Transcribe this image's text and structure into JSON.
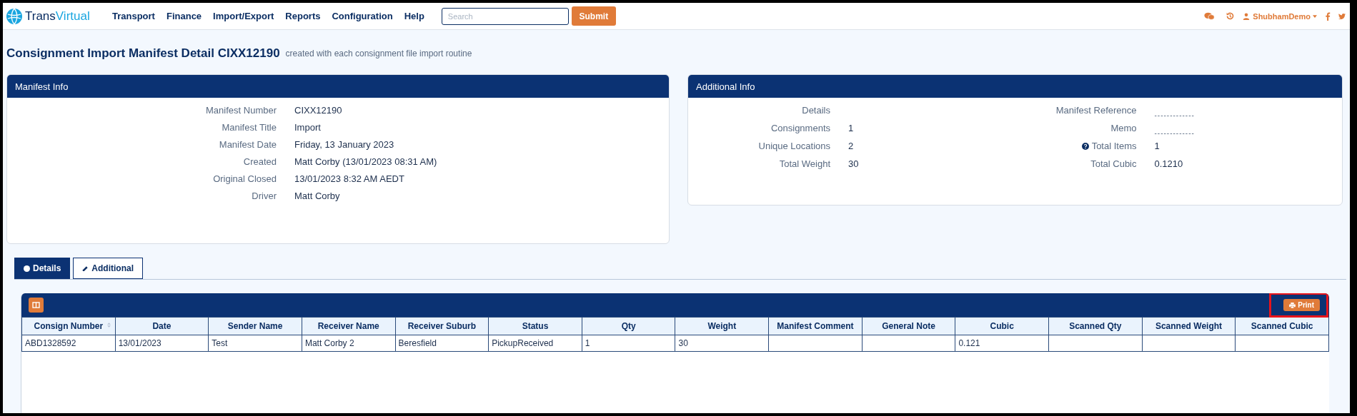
{
  "navbar": {
    "logo": [
      "Trans",
      "Virtual"
    ],
    "menu": [
      "Transport",
      "Finance",
      "Import/Export",
      "Reports",
      "Configuration",
      "Help"
    ],
    "search": {
      "placeholder": "Search"
    },
    "submit": "Submit",
    "user": "ShubhamDemo"
  },
  "page": {
    "title": "Consignment Import Manifest Detail CIXX12190",
    "subtitle": "created with each consignment file import routine"
  },
  "manifest_info": {
    "title": "Manifest Info",
    "fields": [
      {
        "label": "Manifest Number",
        "value": "CIXX12190"
      },
      {
        "label": "Manifest Title",
        "value": "Import"
      },
      {
        "label": "Manifest Date",
        "value": "Friday, 13 January 2023"
      },
      {
        "label": "Created",
        "value": "Matt Corby (13/01/2023 08:31 AM)"
      },
      {
        "label": "Original Closed",
        "value": "13/01/2023 8:32 AM AEDT"
      },
      {
        "label": "Driver",
        "value": "Matt Corby"
      }
    ]
  },
  "additional_info": {
    "title": "Additional Info",
    "left": [
      {
        "label": "Details"
      },
      {
        "label": "Consignments",
        "value": "1"
      },
      {
        "label": "Unique Locations",
        "value": "2"
      },
      {
        "label": "Total Weight",
        "value": "30"
      }
    ],
    "right": [
      {
        "label": "Manifest Reference",
        "value": "-------------",
        "kind": "empty"
      },
      {
        "label": "Memo",
        "value": "-------------",
        "kind": "empty"
      },
      {
        "label": "Total Items",
        "value": "1",
        "help": true
      },
      {
        "label": "Total Cubic",
        "value": "0.1210"
      }
    ]
  },
  "tabs": [
    {
      "label": "Details",
      "selected": true
    },
    {
      "label": "Additional",
      "selected": false
    }
  ],
  "table": {
    "print": {
      "label": "Print",
      "highlighted": true
    },
    "columns": [
      "Consign Number",
      "Date",
      "Sender Name",
      "Receiver Name",
      "Receiver Suburb",
      "Status",
      "Qty",
      "Weight",
      "Manifest Comment",
      "General Note",
      "Cubic",
      "Scanned Qty",
      "Scanned Weight",
      "Scanned Cubic"
    ],
    "rows": [
      [
        "ABD1328592",
        "13/01/2023",
        "Test",
        "Matt Corby 2",
        "Beresfield",
        "PickupReceived",
        "1",
        "30",
        "",
        "",
        "0.121",
        "",
        "",
        ""
      ]
    ]
  }
}
